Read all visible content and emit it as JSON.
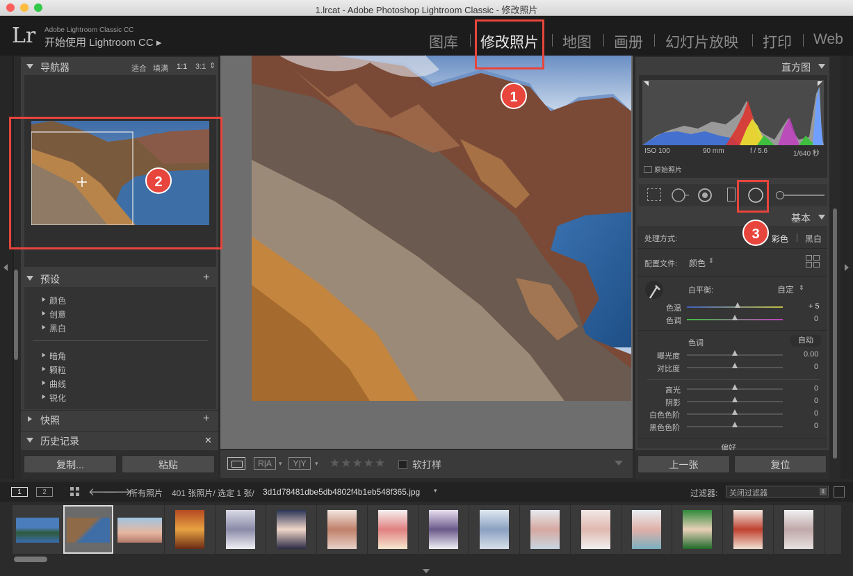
{
  "window": {
    "title": "1.lrcat - Adobe Photoshop Lightroom Classic - 修改照片"
  },
  "identity": {
    "logo": "Lr",
    "product_line1": "Adobe Lightroom Classic CC",
    "product_line2": "开始使用 Lightroom CC ▸"
  },
  "modules": [
    "图库",
    "修改照片",
    "地图",
    "画册",
    "幻灯片放映",
    "打印",
    "Web"
  ],
  "active_module": "修改照片",
  "navigator": {
    "title": "导航器",
    "zoom_options": [
      "适合",
      "填满",
      "1:1",
      "3:1"
    ]
  },
  "presets": {
    "title": "预设",
    "groups_a": [
      "颜色",
      "创意",
      "黑白"
    ],
    "groups_b": [
      "暗角",
      "颗粒",
      "曲线",
      "锐化"
    ]
  },
  "snapshots": {
    "title": "快照"
  },
  "history": {
    "title": "历史记录"
  },
  "left_buttons": {
    "copy": "复制...",
    "paste": "粘贴"
  },
  "toolbar": {
    "ratings": "★★★★★",
    "soft_proof": "软打样"
  },
  "histogram": {
    "title": "直方图",
    "iso": "ISO 100",
    "focal": "90 mm",
    "aperture": "f / 5.6",
    "shutter": "1/640 秒",
    "original_photo": "原始照片"
  },
  "basic": {
    "title": "基本",
    "treatment_label": "处理方式:",
    "treatment_color": "彩色",
    "treatment_bw": "黑白",
    "profile_label": "配置文件:",
    "profile_value": "颜色",
    "wb_label": "白平衡:",
    "wb_value": "自定",
    "temp_label": "色温",
    "temp_value": "+ 5",
    "tint_label": "色调",
    "tint_value": "0",
    "tone_label": "色调",
    "auto": "自动",
    "exposure_label": "曝光度",
    "exposure_value": "0.00",
    "contrast_label": "对比度",
    "contrast_value": "0",
    "highlights_label": "高光",
    "highlights_value": "0",
    "shadows_label": "阴影",
    "shadows_value": "0",
    "whites_label": "白色色阶",
    "whites_value": "0",
    "blacks_label": "黑色色阶",
    "blacks_value": "0",
    "presence_label": "偏好"
  },
  "right_buttons": {
    "previous": "上一张",
    "reset": "复位"
  },
  "filmstrip_bar": {
    "page1": "1",
    "page2": "2",
    "source": "所有照片",
    "info": "401 张照片/ 选定 1 张/",
    "filename": "3d1d78481dbe5db4802f4b1eb548f365.jpg",
    "filter_label": "过滤器:",
    "filter_value": "关闭过滤器"
  },
  "annotations": [
    "1",
    "2",
    "3"
  ],
  "colors": {
    "accent_red": "#e8453c",
    "panel": "#3d3d3d",
    "background": "#2a2a2a"
  }
}
